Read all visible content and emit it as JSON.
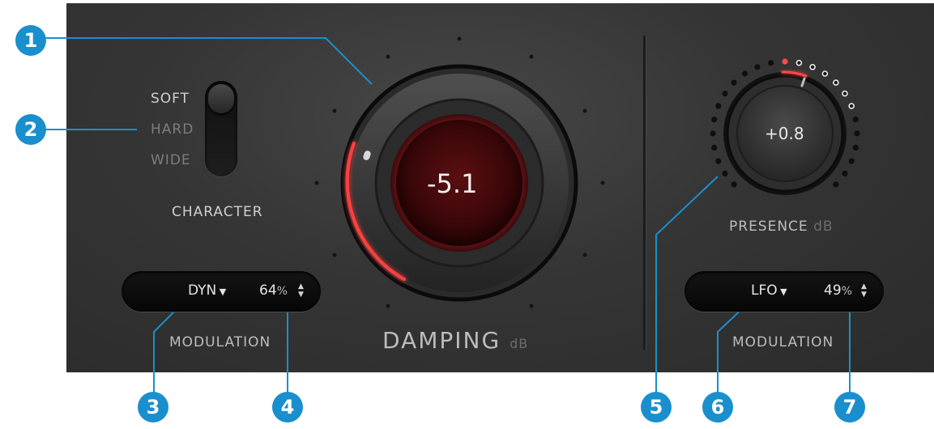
{
  "damping": {
    "value": "-5.1",
    "label": "DAMPING",
    "unit": "dB"
  },
  "character": {
    "label": "CHARACTER",
    "options": [
      "SOFT",
      "HARD",
      "WIDE"
    ],
    "selected": "SOFT"
  },
  "modulation_left": {
    "mode": "DYN",
    "percent": "64",
    "percent_unit": "%",
    "label": "MODULATION"
  },
  "presence": {
    "value": "+0.8",
    "label": "PRESENCE",
    "unit": "dB"
  },
  "modulation_right": {
    "mode": "LFO",
    "percent": "49",
    "percent_unit": "%",
    "label": "MODULATION"
  },
  "annotations": [
    "1",
    "2",
    "3",
    "4",
    "5",
    "6",
    "7"
  ],
  "colors": {
    "accent_red": "#ff3b3b",
    "callout_blue": "#1a8fcd",
    "panel": "#353535"
  }
}
